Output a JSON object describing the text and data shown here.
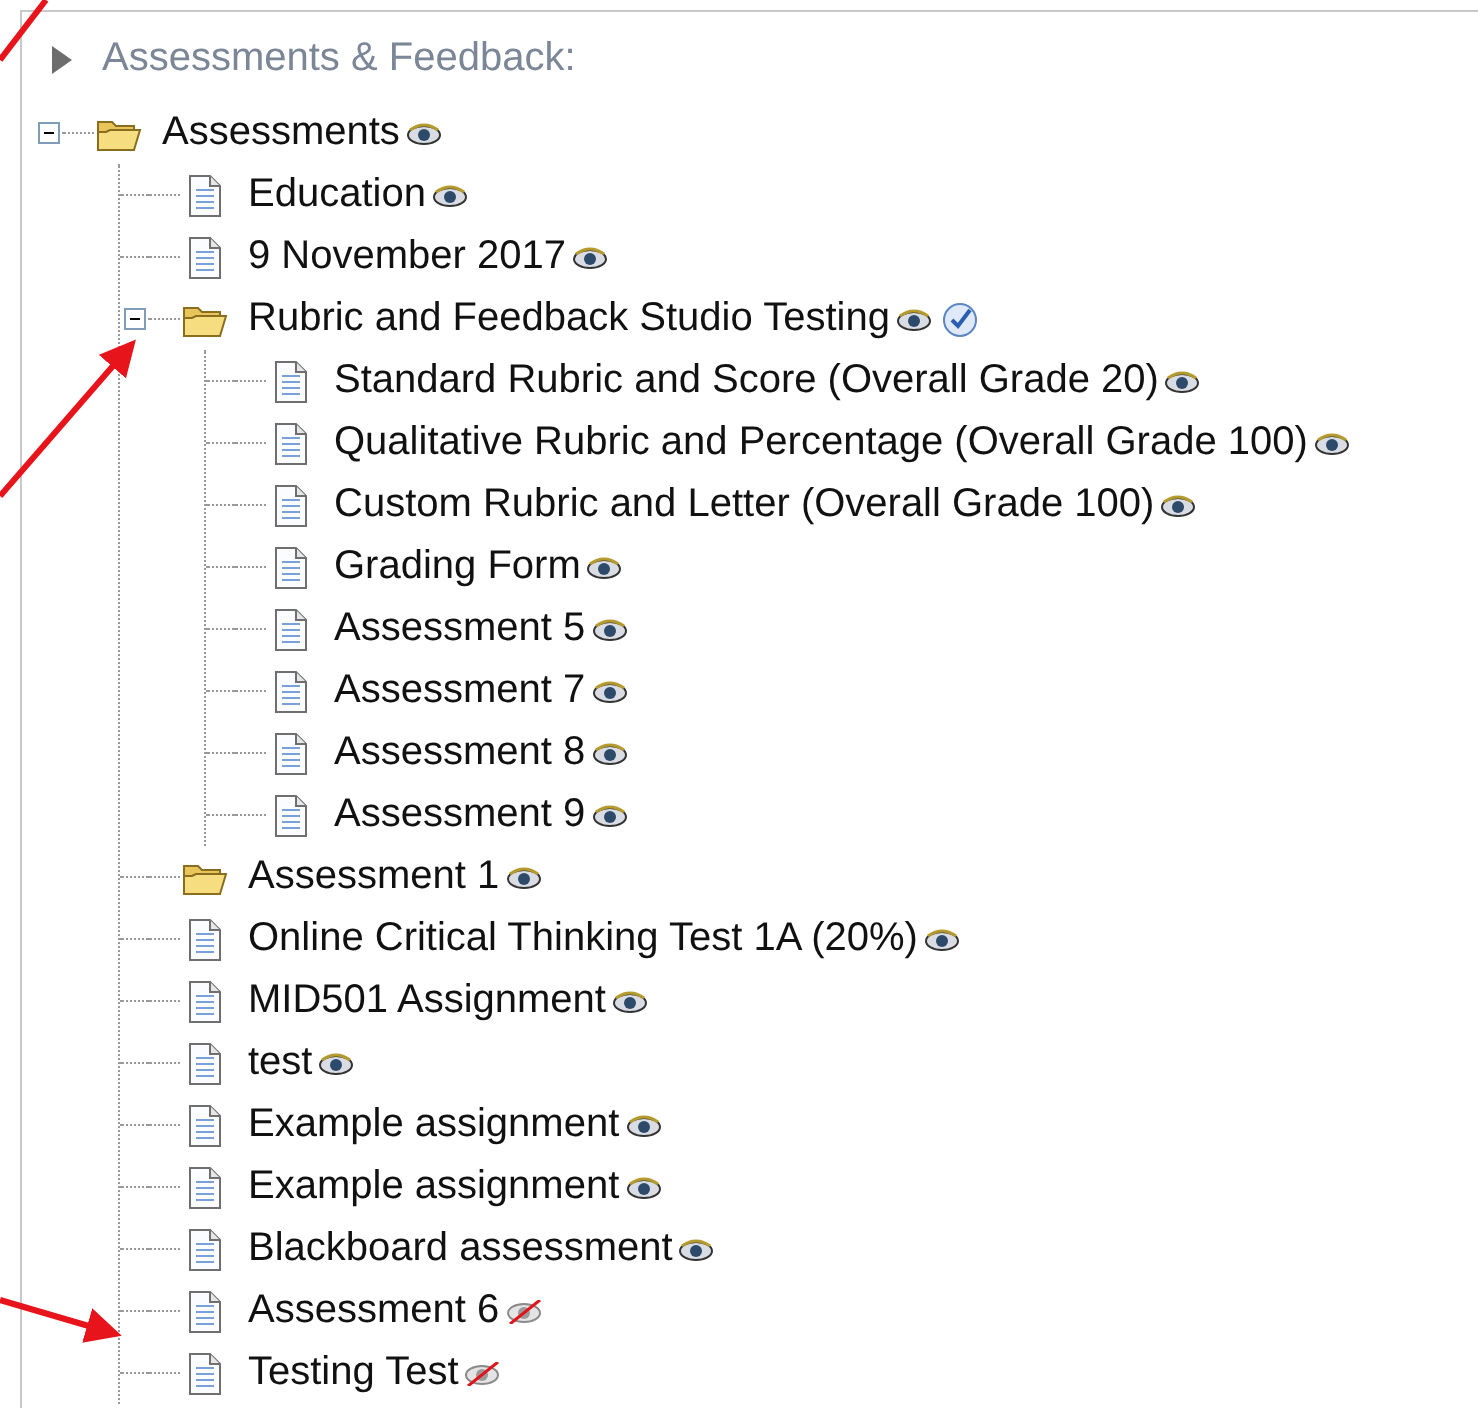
{
  "panel": {
    "title": "Assessments & Feedback:",
    "expanded": false
  },
  "tree": [
    {
      "label": "Assessments",
      "kind": "folder",
      "expanded": true,
      "hidden": false,
      "children": [
        {
          "label": "Education",
          "kind": "file",
          "hidden": false
        },
        {
          "label": "9 November 2017",
          "kind": "file",
          "hidden": false
        },
        {
          "label": "Rubric and Feedback Studio Testing",
          "kind": "folder",
          "expanded": true,
          "hidden": false,
          "verified": true,
          "children": [
            {
              "label": "Standard Rubric and Score (Overall Grade 20)",
              "kind": "file",
              "hidden": false
            },
            {
              "label": "Qualitative Rubric and Percentage (Overall Grade 100)",
              "kind": "file",
              "hidden": false
            },
            {
              "label": "Custom Rubric and Letter (Overall Grade 100)",
              "kind": "file",
              "hidden": false
            },
            {
              "label": "Grading Form",
              "kind": "file",
              "hidden": false
            },
            {
              "label": "Assessment 5",
              "kind": "file",
              "hidden": false
            },
            {
              "label": "Assessment 7",
              "kind": "file",
              "hidden": false
            },
            {
              "label": "Assessment 8",
              "kind": "file",
              "hidden": false
            },
            {
              "label": "Assessment 9",
              "kind": "file",
              "hidden": false
            }
          ]
        },
        {
          "label": "Assessment 1",
          "kind": "folder",
          "hidden": false
        },
        {
          "label": "Online Critical Thinking Test 1A (20%)",
          "kind": "file",
          "hidden": false
        },
        {
          "label": "MID501 Assignment",
          "kind": "file",
          "hidden": false
        },
        {
          "label": "test",
          "kind": "file",
          "hidden": false
        },
        {
          "label": "Example assignment",
          "kind": "file",
          "hidden": false
        },
        {
          "label": "Example assignment",
          "kind": "file",
          "hidden": false
        },
        {
          "label": "Blackboard assessment",
          "kind": "file",
          "hidden": false
        },
        {
          "label": "Assessment 6",
          "kind": "file",
          "hidden": true
        },
        {
          "label": "Testing Test",
          "kind": "file",
          "hidden": true
        }
      ]
    }
  ]
}
